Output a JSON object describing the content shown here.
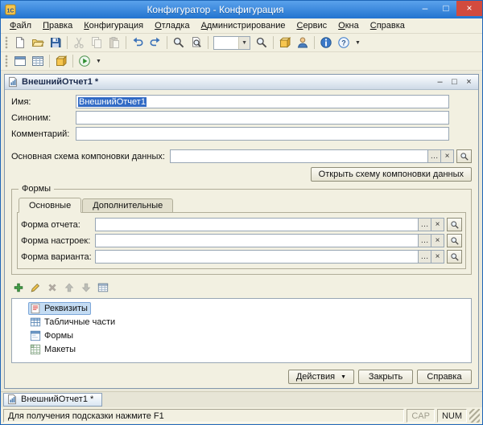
{
  "window": {
    "title": "Конфигуратор - Конфигурация"
  },
  "menu": {
    "items": [
      "Файл",
      "Правка",
      "Конфигурация",
      "Отладка",
      "Администрирование",
      "Сервис",
      "Окна",
      "Справка"
    ]
  },
  "editor": {
    "title": "ВнешнийОтчет1 *",
    "fields": {
      "name": {
        "label": "Имя:",
        "value": "ВнешнийОтчет1"
      },
      "synonym": {
        "label": "Синоним:",
        "value": ""
      },
      "comment": {
        "label": "Комментарий:",
        "value": ""
      },
      "dcs": {
        "label": "Основная схема компоновки данных:",
        "value": ""
      }
    },
    "open_dcs_button": "Открыть схему компоновки данных",
    "forms_group": {
      "title": "Формы",
      "tabs": [
        "Основные",
        "Дополнительные"
      ],
      "rows": [
        {
          "label": "Форма отчета:",
          "value": ""
        },
        {
          "label": "Форма настроек:",
          "value": ""
        },
        {
          "label": "Форма варианта:",
          "value": ""
        }
      ]
    },
    "tree": {
      "items": [
        {
          "label": "Реквизиты"
        },
        {
          "label": "Табличные части"
        },
        {
          "label": "Формы"
        },
        {
          "label": "Макеты"
        }
      ]
    },
    "footer": {
      "actions": "Действия",
      "close": "Закрыть",
      "help": "Справка"
    }
  },
  "taskbar": {
    "tab": "ВнешнийОтчет1 *"
  },
  "statusbar": {
    "hint": "Для получения подсказки нажмите F1",
    "cap": "CAP",
    "num": "NUM"
  },
  "glyphs": {
    "minimize": "–",
    "maximize": "□",
    "restore": "□",
    "close": "×",
    "ellipsis": "…",
    "clear": "×",
    "dropdown": "▼"
  },
  "colors": {
    "titlebar": "#2374CF",
    "chrome": "#F2F0E1",
    "selection": "#316AC5",
    "tree_selection": "#C4DCF3"
  }
}
